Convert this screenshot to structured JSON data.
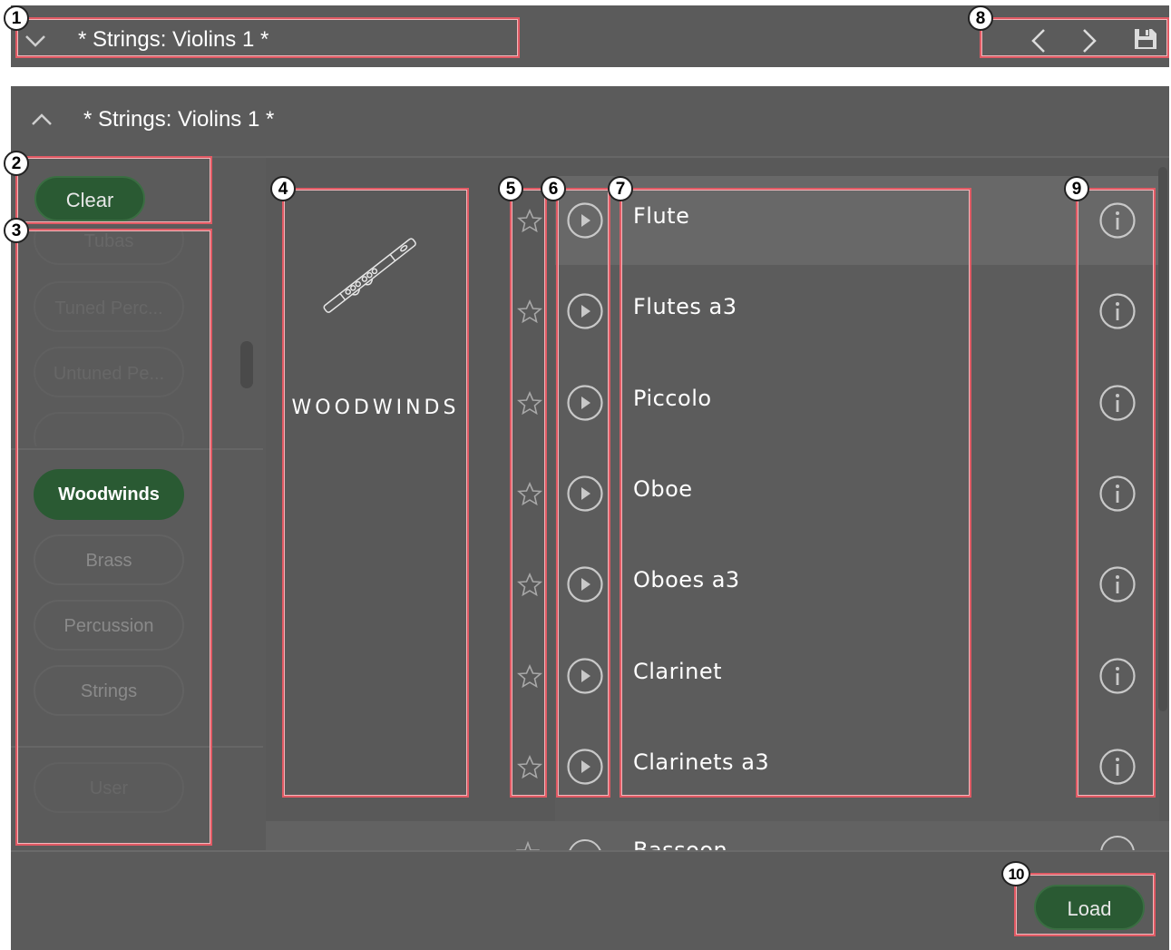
{
  "topbar": {
    "title": "* Strings: Violins 1 *",
    "prev_icon": "chevron-left-icon",
    "next_icon": "chevron-right-icon",
    "save_icon": "floppy-disk-icon"
  },
  "panel": {
    "title": "* Strings: Violins 1 *"
  },
  "filters": {
    "clear_label": "Clear",
    "scrolled_items": [
      "Tubas",
      "Tuned Perc...",
      "Untuned Pe..."
    ],
    "categories": [
      "Woodwinds",
      "Brass",
      "Percussion",
      "Strings"
    ],
    "selected": "Woodwinds",
    "user_label": "User"
  },
  "category_panel": {
    "label": "WOODWINDS",
    "image": "flute-icon"
  },
  "instruments": [
    {
      "name": "Flute"
    },
    {
      "name": "Flutes a3"
    },
    {
      "name": "Piccolo"
    },
    {
      "name": "Oboe"
    },
    {
      "name": "Oboes a3"
    },
    {
      "name": "Clarinet"
    },
    {
      "name": "Clarinets a3"
    },
    {
      "name": "Bassoon"
    }
  ],
  "footer": {
    "load_label": "Load"
  },
  "markers": [
    "1",
    "2",
    "3",
    "4",
    "5",
    "6",
    "7",
    "8",
    "9",
    "10"
  ],
  "colors": {
    "accent_green": "#2a5a33",
    "panel_bg": "#5b5b5b",
    "annotation": "#e05a64"
  }
}
